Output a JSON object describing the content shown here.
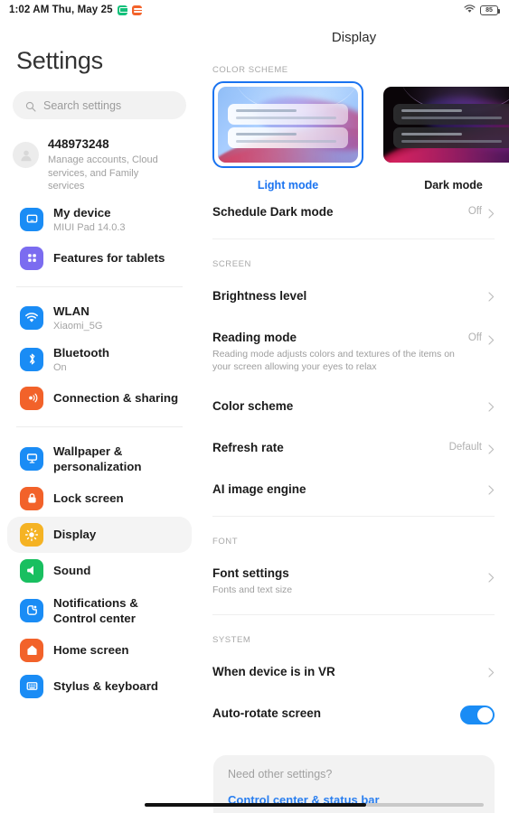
{
  "statusbar": {
    "time": "1:02 AM Thu, May 25",
    "icons": [
      "app-badge-green",
      "app-badge-orange"
    ],
    "wifi": "wifi-icon",
    "battery_level": "85"
  },
  "sidebar": {
    "title": "Settings",
    "search": {
      "placeholder": "Search settings",
      "icon": "search-icon"
    },
    "account": {
      "id": "448973248",
      "subtitle": "Manage accounts, Cloud services, and Family services",
      "avatar": "person-avatar-icon"
    },
    "items": [
      {
        "label": "My device",
        "sub": "MIUI Pad 14.0.3",
        "icon": "tablet-icon",
        "color": "#1a8cf5",
        "selected": false
      },
      {
        "label": "Features for tablets",
        "sub": "",
        "icon": "grid-apps-icon",
        "color": "#7b6cf0",
        "selected": false
      },
      {
        "label": "WLAN",
        "sub": "Xiaomi_5G",
        "icon": "wifi-icon",
        "color": "#1a8cf5",
        "selected": false
      },
      {
        "label": "Bluetooth",
        "sub": "On",
        "icon": "bluetooth-icon",
        "color": "#1a8cf5",
        "selected": false
      },
      {
        "label": "Connection & sharing",
        "sub": "",
        "icon": "connection-sharing-icon",
        "color": "#f2622a",
        "selected": false
      },
      {
        "label": "Wallpaper & personalization",
        "sub": "",
        "icon": "wallpaper-icon",
        "color": "#1a8cf5",
        "selected": false
      },
      {
        "label": "Lock screen",
        "sub": "",
        "icon": "lock-icon",
        "color": "#f2622a",
        "selected": false
      },
      {
        "label": "Display",
        "sub": "",
        "icon": "brightness-sun-icon",
        "color": "#f5b324",
        "selected": true
      },
      {
        "label": "Sound",
        "sub": "",
        "icon": "speaker-icon",
        "color": "#19bf60",
        "selected": false
      },
      {
        "label": "Notifications & Control center",
        "sub": "",
        "icon": "notification-icon",
        "color": "#1a8cf5",
        "selected": false
      },
      {
        "label": "Home screen",
        "sub": "",
        "icon": "home-icon",
        "color": "#f2622a",
        "selected": false
      },
      {
        "label": "Stylus & keyboard",
        "sub": "",
        "icon": "keyboard-icon",
        "color": "#1a8cf5",
        "selected": false
      }
    ]
  },
  "content": {
    "page_title": "Display",
    "sections": {
      "color_scheme_label": "COLOR SCHEME",
      "screen_label": "SCREEN",
      "font_label": "FONT",
      "system_label": "SYSTEM"
    },
    "schemes": [
      {
        "name": "Light mode",
        "selected": true
      },
      {
        "name": "Dark mode",
        "selected": false
      }
    ],
    "rows": {
      "schedule_dark": {
        "title": "Schedule Dark mode",
        "value": "Off",
        "desc": ""
      },
      "brightness": {
        "title": "Brightness level",
        "value": "",
        "desc": ""
      },
      "reading_mode": {
        "title": "Reading mode",
        "desc": "Reading mode adjusts colors and textures of the items on your screen allowing your eyes to relax",
        "value": "Off"
      },
      "color_scheme": {
        "title": "Color scheme",
        "value": "",
        "desc": ""
      },
      "refresh_rate": {
        "title": "Refresh rate",
        "value": "Default",
        "desc": ""
      },
      "ai_image_engine": {
        "title": "AI image engine",
        "value": "",
        "desc": ""
      },
      "font_settings": {
        "title": "Font settings",
        "desc": "Fonts and text size",
        "value": ""
      },
      "vr": {
        "title": "When device is in VR",
        "value": "",
        "desc": ""
      },
      "auto_rotate": {
        "title": "Auto-rotate screen",
        "value": "",
        "desc": "",
        "toggle_on": true
      }
    },
    "need_other": {
      "title": "Need other settings?",
      "link": "Control center & status bar"
    }
  },
  "colors": {
    "accent": "#1a73f0",
    "toggle_on": "#1a8cf5",
    "selected_bg": "#f4f4f4"
  }
}
